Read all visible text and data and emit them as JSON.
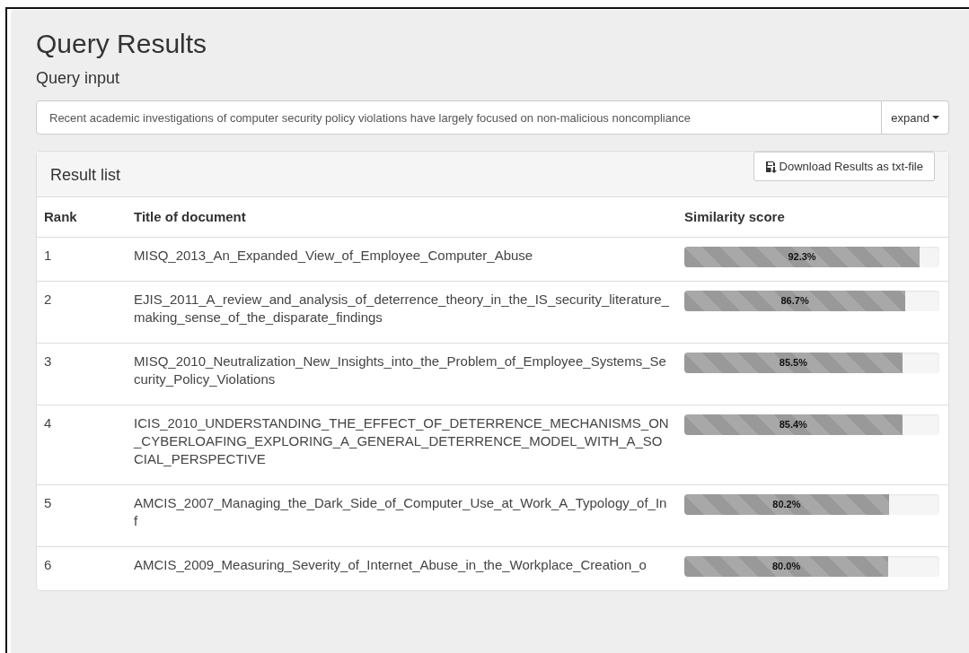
{
  "title": "Query Results",
  "query": {
    "label": "Query input",
    "value": "Recent academic investigations of computer security policy violations have largely focused on non-malicious noncompliance",
    "button": "expand"
  },
  "results": {
    "heading": "Result list",
    "download_button": "Download Results as txt-file",
    "columns": [
      "Rank",
      "Title of document",
      "Similarity score"
    ],
    "rows": [
      {
        "rank": "1",
        "title": "MISQ_2013_An_Expanded_View_of_Employee_Computer_Abuse",
        "level": 0.923,
        "reading": "92.3%"
      },
      {
        "rank": "2",
        "title": "EJIS_2011_A_review_and_analysis_of_deterrence_theory_in_the_IS_security_literature_making_sense_of_the_disparate_findings",
        "level": 0.867,
        "reading": "86.7%"
      },
      {
        "rank": "3",
        "title": "MISQ_2010_Neutralization_New_Insights_into_the_Problem_of_Employee_Systems_Security_Policy_Violations",
        "level": 0.855,
        "reading": "85.5%"
      },
      {
        "rank": "4",
        "title": "ICIS_2010_UNDERSTANDING_THE_EFFECT_OF_DETERRENCE_MECHANISMS_ON_CYBERLOAFING_EXPLORING_A_GENERAL_DETERRENCE_MODEL_WITH_A_SOCIAL_PERSPECTIVE",
        "level": 0.854,
        "reading": "85.4%"
      },
      {
        "rank": "5",
        "title": "AMCIS_2007_Managing_the_Dark_Side_of_Computer_Use_at_Work_A_Typology_of_Inf",
        "level": 0.802,
        "reading": "80.2%"
      },
      {
        "rank": "6",
        "title": "AMCIS_2009_Measuring_Severity_of_Internet_Abuse_in_the_Workplace_Creation_o",
        "level": 0.8,
        "reading": "80.0%"
      }
    ]
  }
}
